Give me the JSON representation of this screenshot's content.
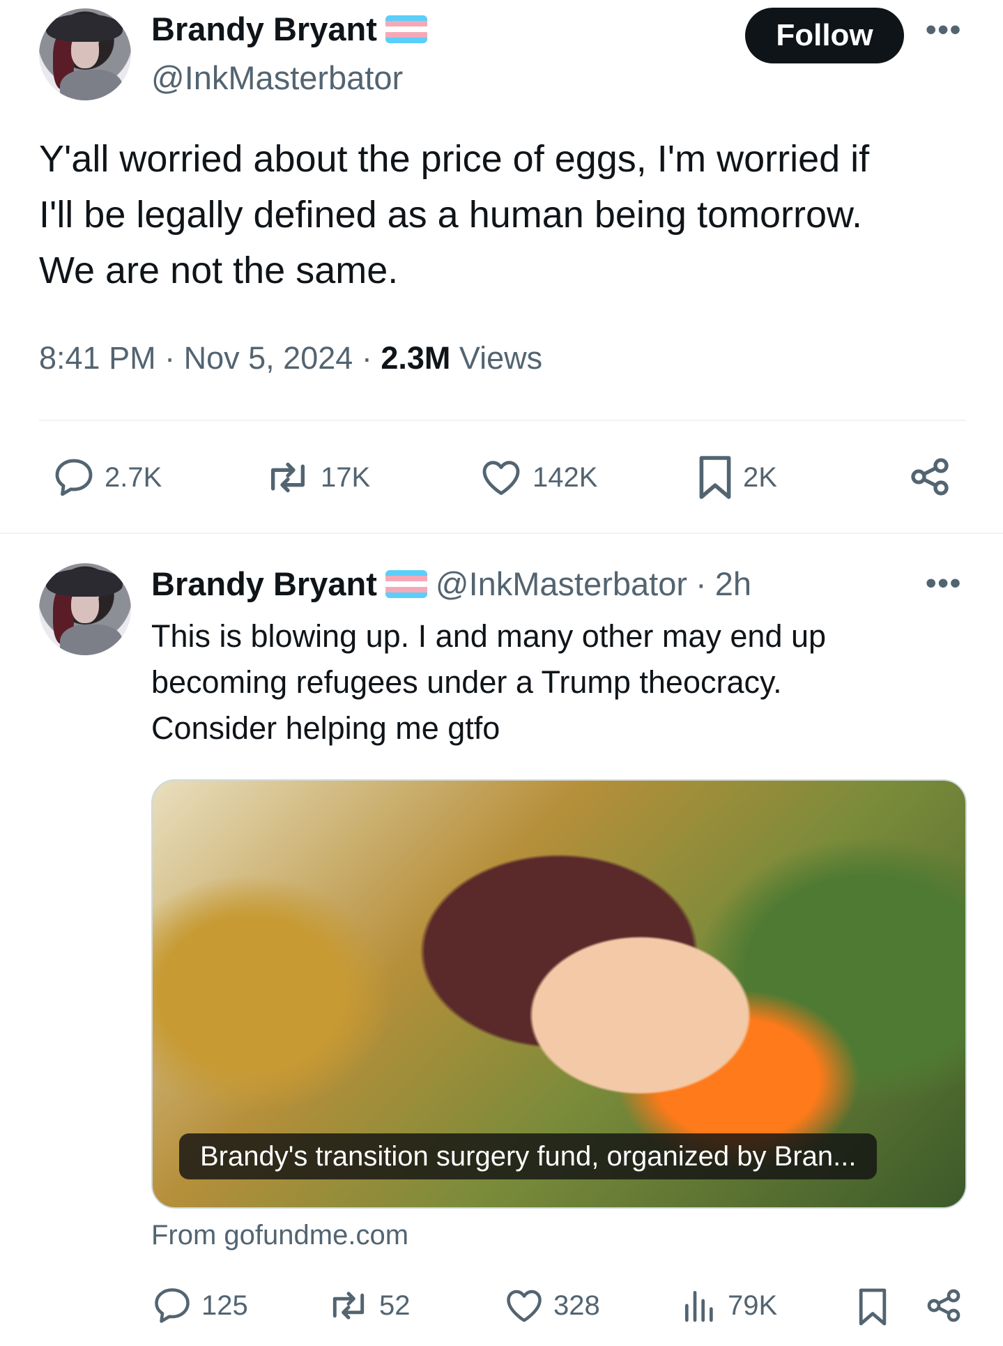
{
  "main_tweet": {
    "author": {
      "name": "Brandy Bryant",
      "handle": "@InkMasterbator",
      "flag_colors": [
        "#5bcefa",
        "#f5a9b8",
        "#ffffff",
        "#f5a9b8",
        "#5bcefa"
      ]
    },
    "follow_label": "Follow",
    "more_icon": "more-dots-icon",
    "text": [
      "Y'all worried about the price of eggs, I'm worried if",
      "I'll be legally defined as a human being tomorrow.",
      "We are not the same."
    ],
    "time": "8:41 PM",
    "date": "Nov 5, 2024",
    "separator": "·",
    "views_count": "2.3M",
    "views_label": "Views",
    "actions": {
      "replies": "2.7K",
      "reposts": "17K",
      "likes": "142K",
      "bookmarks": "2K"
    }
  },
  "reply_tweet": {
    "author": {
      "name": "Brandy Bryant",
      "handle": "@InkMasterbator",
      "age": "2h"
    },
    "text": [
      "This is blowing up. I and many other may end up",
      "becoming refugees under a Trump theocracy.",
      "Consider helping me gtfo"
    ],
    "card": {
      "caption": "Brandy's transition surgery fund, organized by Bran...",
      "source": "From gofundme.com"
    },
    "actions": {
      "replies": "125",
      "reposts": "52",
      "likes": "328",
      "views": "79K"
    }
  },
  "colors": {
    "text_primary": "#0f1419",
    "text_secondary": "#536471",
    "divider": "#eff3f4"
  }
}
